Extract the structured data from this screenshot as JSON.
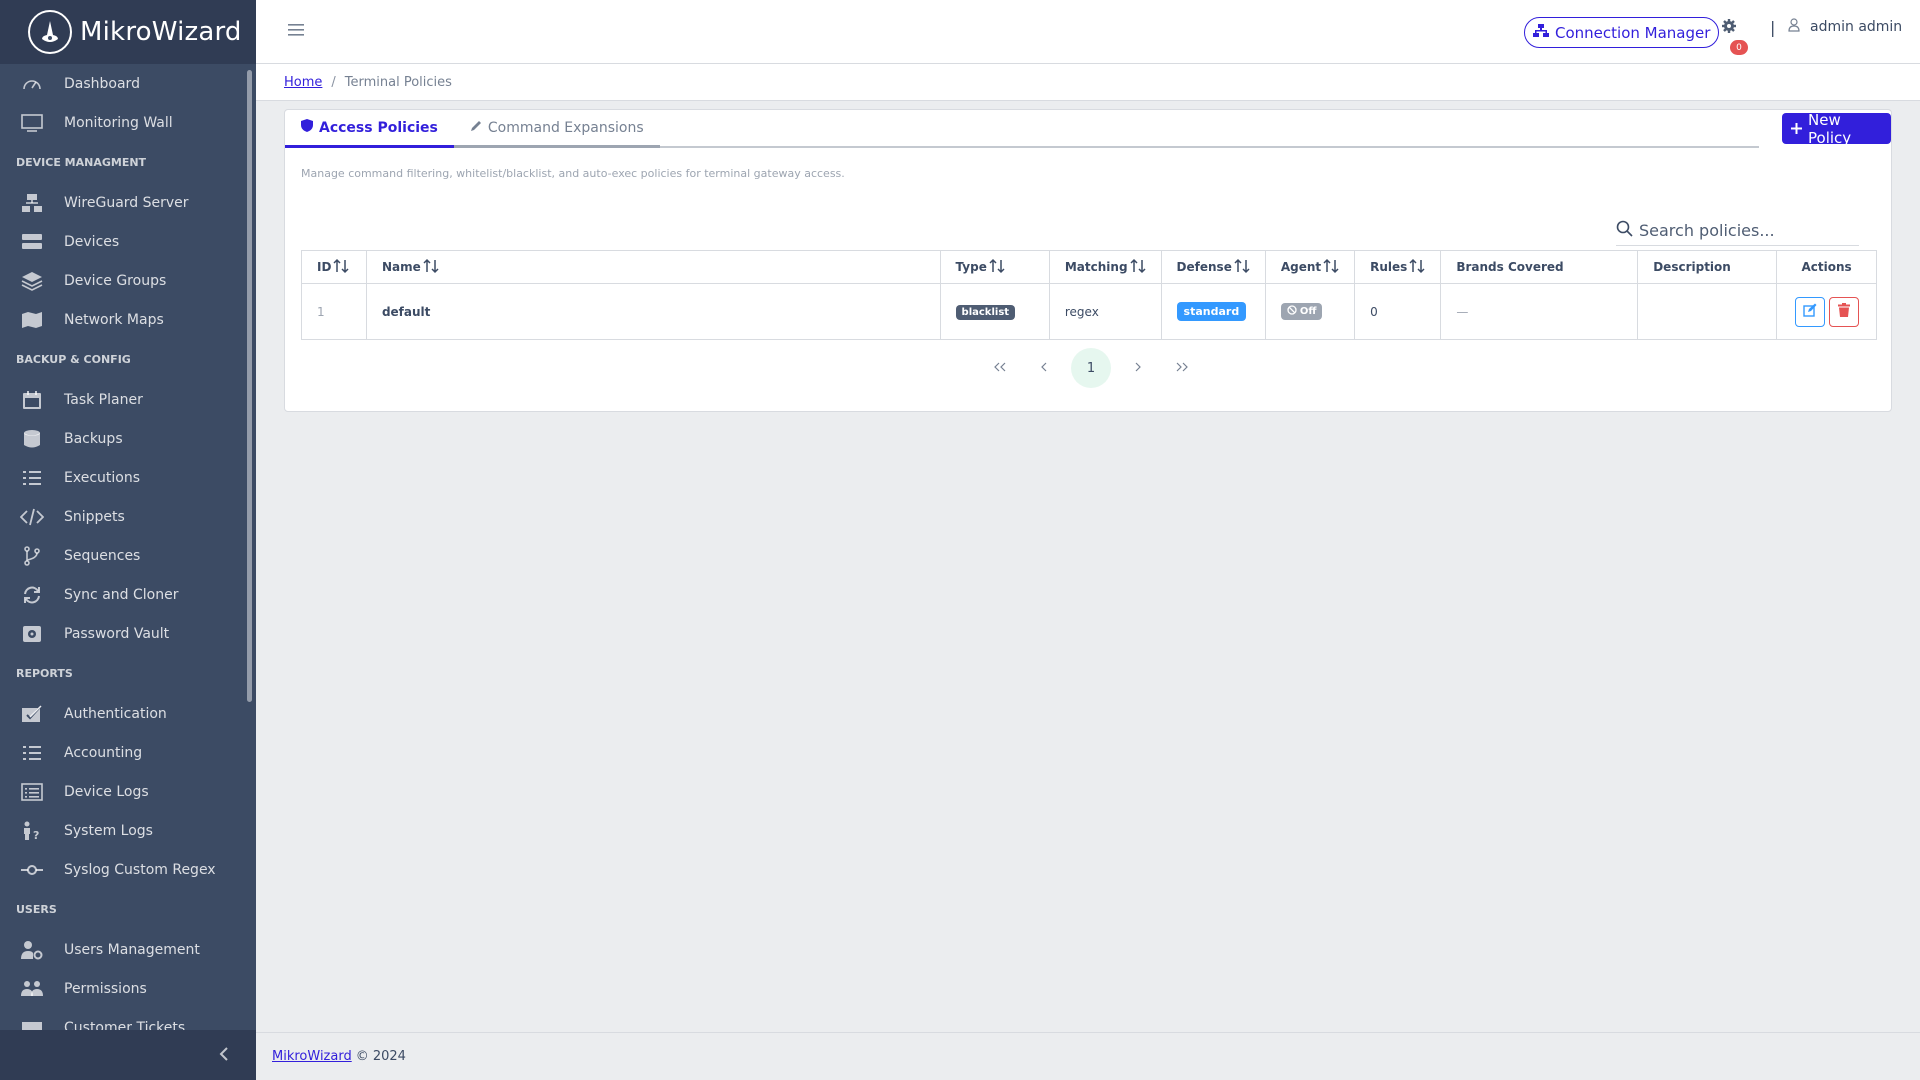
{
  "brand": {
    "name": "MikroWizard"
  },
  "sidebar": {
    "top_items": [
      {
        "label": "Dashboard",
        "icon": "speedometer-icon"
      },
      {
        "label": "Monitoring Wall",
        "icon": "monitor-icon"
      }
    ],
    "sections": [
      {
        "title": "DEVICE MANAGMENT",
        "items": [
          {
            "label": "WireGuard Server",
            "icon": "network-icon"
          },
          {
            "label": "Devices",
            "icon": "storage-icon"
          },
          {
            "label": "Device Groups",
            "icon": "layers-icon"
          },
          {
            "label": "Network Maps",
            "icon": "map-icon"
          }
        ]
      },
      {
        "title": "BACKUP & CONFIG",
        "items": [
          {
            "label": "Task Planer",
            "icon": "calendar-icon"
          },
          {
            "label": "Backups",
            "icon": "database-icon"
          },
          {
            "label": "Executions",
            "icon": "list-icon"
          },
          {
            "label": "Snippets",
            "icon": "code-icon"
          },
          {
            "label": "Sequences",
            "icon": "branch-icon"
          },
          {
            "label": "Sync and Cloner",
            "icon": "sync-icon"
          },
          {
            "label": "Password Vault",
            "icon": "vault-icon"
          }
        ]
      },
      {
        "title": "REPORTS",
        "items": [
          {
            "label": "Authentication",
            "icon": "check-calendar-icon"
          },
          {
            "label": "Accounting",
            "icon": "list-icon"
          },
          {
            "label": "Device Logs",
            "icon": "log-list-icon"
          },
          {
            "label": "System Logs",
            "icon": "person-question-icon"
          },
          {
            "label": "Syslog Custom Regex",
            "icon": "commit-icon"
          }
        ]
      },
      {
        "title": "USERS",
        "items": [
          {
            "label": "Users Management",
            "icon": "user-gear-icon"
          },
          {
            "label": "Permissions",
            "icon": "people-icon"
          },
          {
            "label": "Customer Tickets",
            "icon": "ticket-icon"
          }
        ]
      }
    ]
  },
  "header": {
    "connection_manager_label": "Connection Manager",
    "notification_count": "0",
    "divider": "|",
    "user_name": "admin admin"
  },
  "breadcrumb": {
    "home": "Home",
    "separator": "/",
    "current": "Terminal Policies"
  },
  "tabs": [
    {
      "label": "Access Policies"
    },
    {
      "label": "Command Expansions"
    }
  ],
  "new_policy_label": "New Policy",
  "description": "Manage command filtering, whitelist/blacklist, and auto-exec policies for terminal gateway access.",
  "search": {
    "placeholder": "Search policies..."
  },
  "table": {
    "headers": {
      "id": "ID",
      "name": "Name",
      "type": "Type",
      "matching": "Matching",
      "defense": "Defense",
      "agent": "Agent",
      "rules": "Rules",
      "brands": "Brands Covered",
      "description": "Description",
      "actions": "Actions"
    },
    "rows": [
      {
        "id": "1",
        "name": "default",
        "type": "blacklist",
        "matching": "regex",
        "defense": "standard",
        "agent": "Off",
        "rules": "0",
        "brands": "—",
        "description": ""
      }
    ]
  },
  "pagination": {
    "current_page": "1"
  },
  "footer": {
    "link": "MikroWizard",
    "text": "© 2024"
  },
  "colors": {
    "primary": "#321fdb",
    "sidebar": "#3c4b64",
    "danger": "#e55353",
    "info": "#3399ff"
  }
}
